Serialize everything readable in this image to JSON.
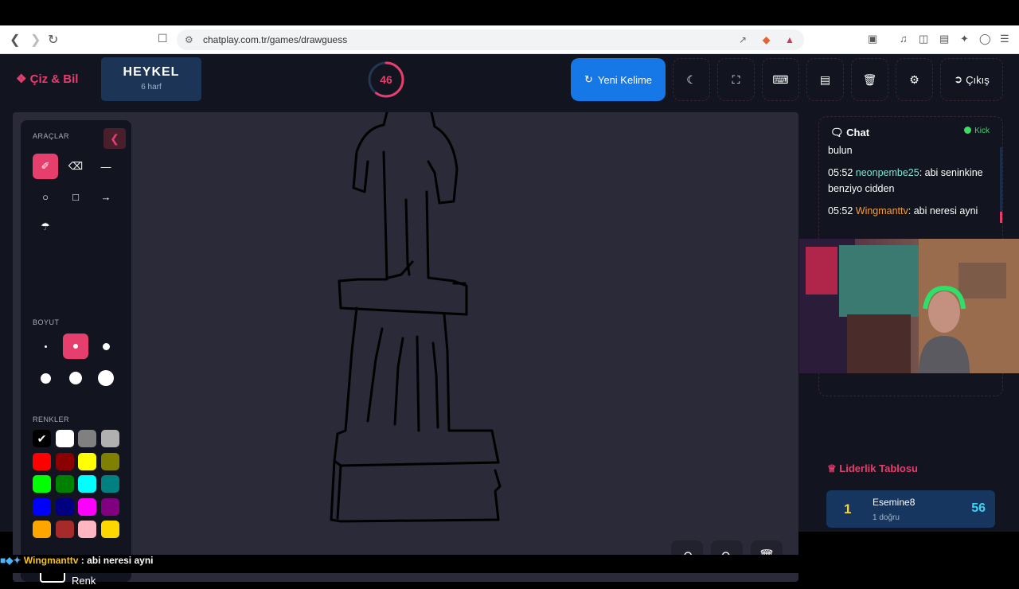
{
  "browser": {
    "url": "chatplay.com.tr/games/drawguess"
  },
  "header": {
    "logo_label": "Çiz & Bil",
    "word": "HEYKEL",
    "word_hint": "6 harf",
    "timer": "46",
    "timer_progress": 0.6,
    "new_word_label": "Yeni Kelime",
    "exit_label": "Çıkış",
    "accent_color": "#e63e6d",
    "primary_color": "#1677e6"
  },
  "tools": {
    "section_tools": "ARAÇLAR",
    "section_size": "BOYUT",
    "section_colors": "RENKLER",
    "custom_color_label": "Özel Renk",
    "colors": [
      "#000000",
      "#ffffff",
      "#808080",
      "#b0b0b0",
      "#ff0000",
      "#8b0000",
      "#ffff00",
      "#808000",
      "#00ff00",
      "#008000",
      "#00ffff",
      "#008080",
      "#0000ff",
      "#000080",
      "#ff00ff",
      "#800080",
      "#ffa500",
      "#a52a2a",
      "#ffb6c1",
      "#ffd700"
    ]
  },
  "chat": {
    "title": "Chat",
    "status": "Kick",
    "messages": [
      {
        "text": "bulun"
      },
      {
        "time": "05:52",
        "user": "neonpembe25",
        "text": ": abi seninkine benziyo cidden"
      },
      {
        "time": "05:52",
        "user": "Wingmanttv",
        "text": ": abi neresi ayni"
      }
    ]
  },
  "leaderboard": {
    "title": "Liderlik Tablosu",
    "entries": [
      {
        "rank": "1",
        "name": "Esemine8",
        "sub": "1 doğru",
        "score": "56"
      }
    ]
  },
  "ticker": {
    "user": "Wingmanttv",
    "text": ": abi neresi ayni"
  }
}
